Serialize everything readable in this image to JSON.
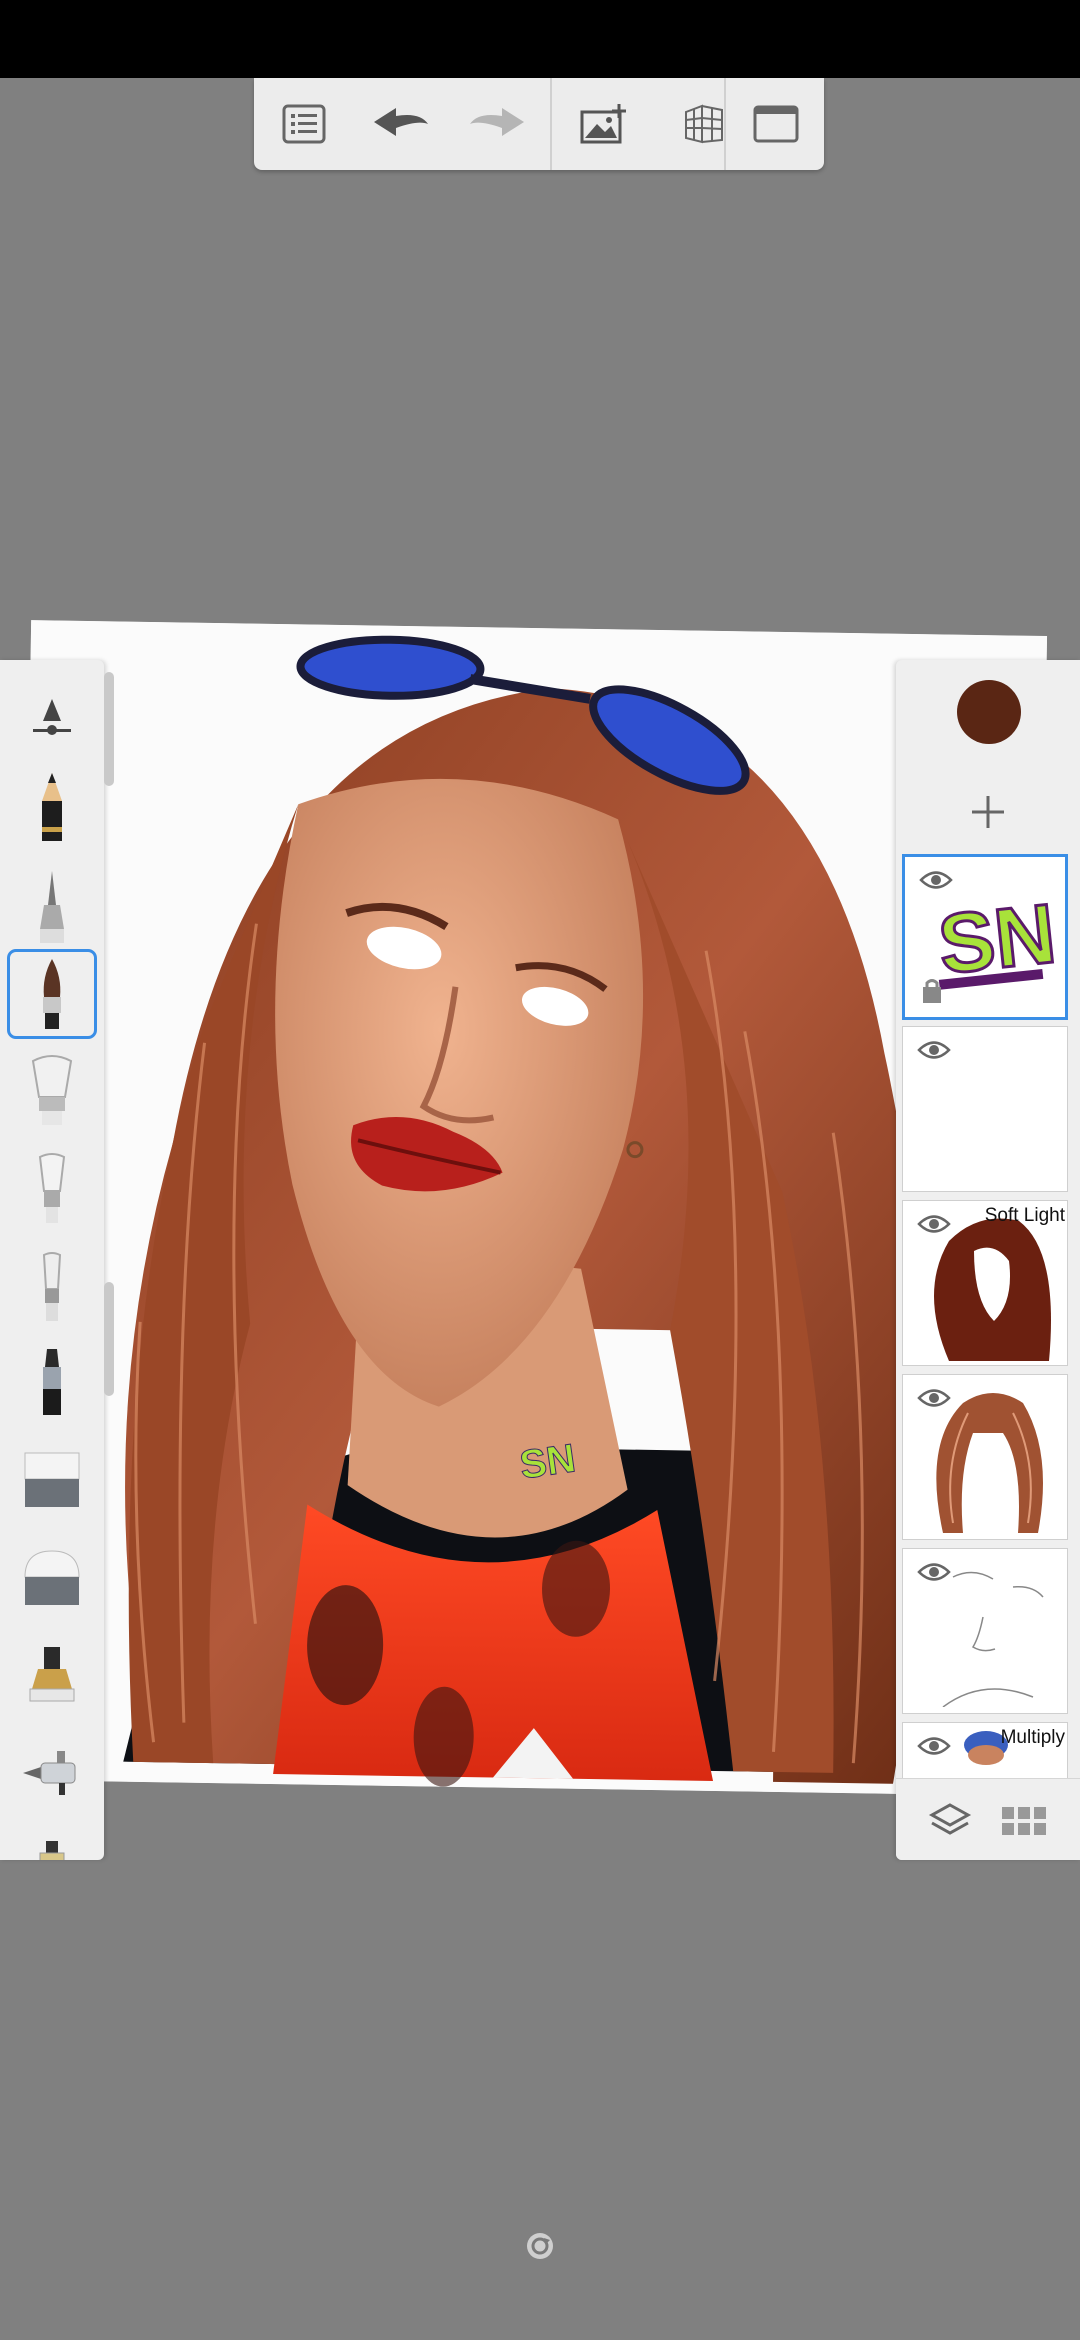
{
  "toolbar": {
    "icons": [
      "list-icon",
      "undo-icon",
      "redo-icon",
      "add-image-icon",
      "perspective-guide-icon",
      "fullscreen-icon"
    ]
  },
  "brushes": {
    "items": [
      "brush-size-icon",
      "pencil-icon",
      "ballpoint-pen-icon",
      "paintbrush-icon",
      "soft-brush-icon",
      "airbrush-icon",
      "smudge-brush-icon",
      "marker-icon",
      "eraser-icon",
      "soft-eraser-icon",
      "stamp-icon",
      "airbrush-nozzle-icon",
      "spray-icon"
    ],
    "selected": "paintbrush-icon"
  },
  "layers": {
    "current_color": "#5a2614",
    "items": [
      {
        "name": "layer-watermark",
        "blend": ""
      },
      {
        "name": "layer-empty",
        "blend": ""
      },
      {
        "name": "layer-hair-soft-light",
        "blend": "Soft Light"
      },
      {
        "name": "layer-hair-strands",
        "blend": ""
      },
      {
        "name": "layer-sketch",
        "blend": ""
      },
      {
        "name": "layer-multiply",
        "blend": "Multiply"
      }
    ],
    "selected_index": 0
  },
  "canvas": {
    "watermark_text": "SN"
  },
  "accent": "#3a8ee6"
}
